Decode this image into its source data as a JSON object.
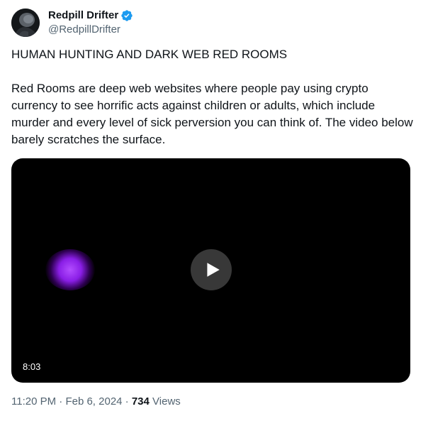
{
  "author": {
    "display_name": "Redpill Drifter",
    "handle": "@RedpillDrifter",
    "verified": true,
    "verified_color": "#1d9bf0"
  },
  "post": {
    "title_line": "HUMAN HUNTING AND DARK WEB RED ROOMS",
    "body": "Red Rooms are deep web websites where people pay using crypto currency to see horrific acts against children or adults, which include murder and every level of sick perversion you can think of. The video below barely scratches the surface."
  },
  "video": {
    "duration": "8:03"
  },
  "meta": {
    "time": "11:20 PM",
    "separator": "·",
    "date": "Feb 6, 2024",
    "views_count": "734",
    "views_label": "Views"
  },
  "colors": {
    "text_primary": "#0f1419",
    "text_secondary": "#536471",
    "video_bg": "#000000",
    "glow": "#8a1ee6"
  }
}
